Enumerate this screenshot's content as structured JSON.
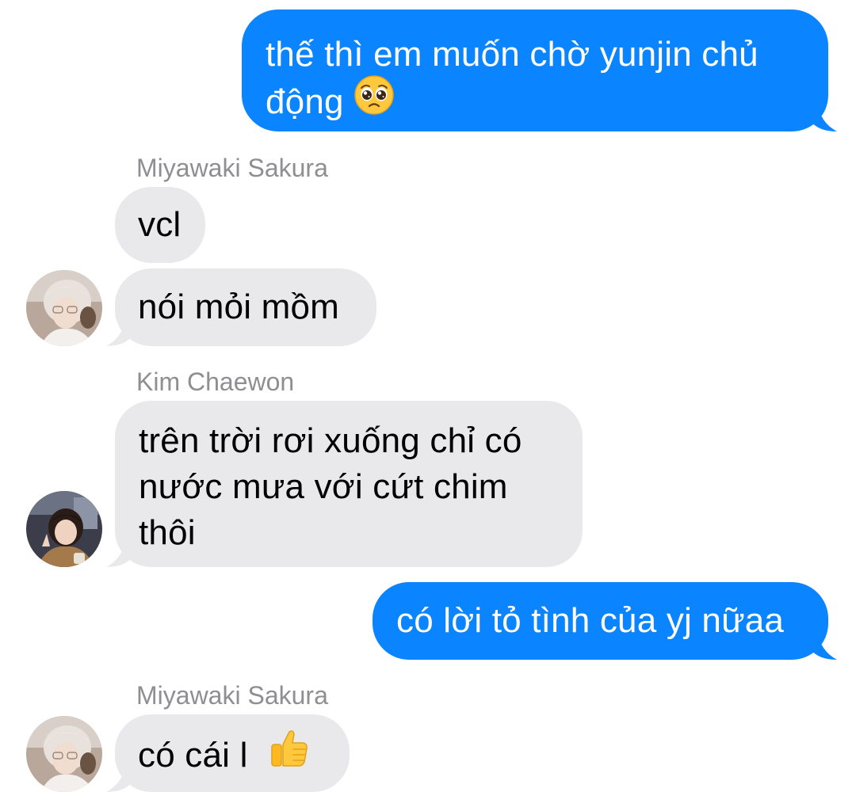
{
  "conversation": {
    "messages": [
      {
        "direction": "outgoing",
        "text_line1": "thế thì em muốn chờ yunjin chủ",
        "text_line2": "động",
        "emoji": "pleading-face-icon"
      },
      {
        "direction": "incoming",
        "sender": "Miyawaki Sakura",
        "text": "vcl"
      },
      {
        "direction": "incoming",
        "sender": "Miyawaki Sakura",
        "text": "nói mỏi mồm"
      },
      {
        "direction": "incoming",
        "sender": "Kim Chaewon",
        "text": "trên trời rơi xuống chỉ có\nnước mưa với cứt chim\nthôi"
      },
      {
        "direction": "outgoing",
        "text": "có lời tỏ tình của yj nữaa"
      },
      {
        "direction": "incoming",
        "sender": "Miyawaki Sakura",
        "text": "có cái l",
        "emoji": "thumbs-up-icon"
      }
    ]
  },
  "colors": {
    "outgoing_bubble": "#0a84ff",
    "incoming_bubble": "#e9e9eb",
    "sender_name": "#8e8e93",
    "background": "#ffffff"
  }
}
